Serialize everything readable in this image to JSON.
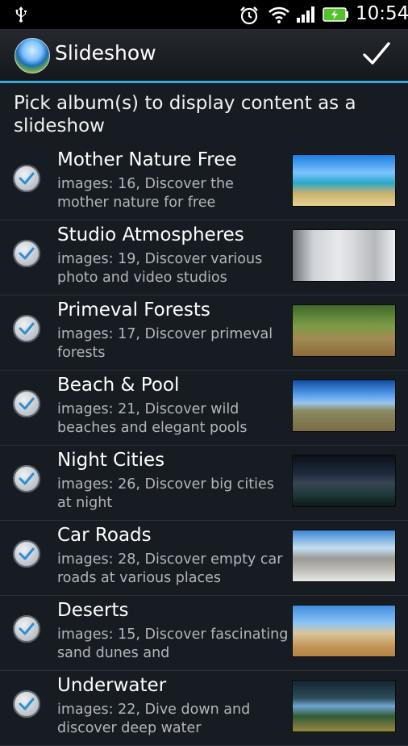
{
  "status_bar": {
    "time": "10:54",
    "icons": [
      "usb-icon",
      "alarm-icon",
      "wifi-icon",
      "signal-icon",
      "battery-charging-icon"
    ]
  },
  "action_bar": {
    "title": "Slideshow",
    "app_icon": "panorama-globe-icon",
    "confirm_icon": "checkmark-icon"
  },
  "heading": "Pick album(s) to display content as a slideshow",
  "albums": [
    {
      "name": "Mother Nature Free",
      "description": "images: 16, Discover the mother nature for free",
      "checked": true
    },
    {
      "name": "Studio Atmospheres",
      "description": "images: 19, Discover various photo and video studios",
      "checked": true
    },
    {
      "name": "Primeval Forests",
      "description": "images: 17, Discover primeval forests",
      "checked": true
    },
    {
      "name": "Beach & Pool",
      "description": "images: 21, Discover wild beaches and elegant pools",
      "checked": true
    },
    {
      "name": "Night Cities",
      "description": "images: 26, Discover big cities at night",
      "checked": true
    },
    {
      "name": "Car Roads",
      "description": "images: 28, Discover empty car roads at various places",
      "checked": true
    },
    {
      "name": "Deserts",
      "description": "images: 15, Discover fascinating sand dunes and",
      "checked": true
    },
    {
      "name": "Underwater",
      "description": "images: 22, Dive down and discover deep water",
      "checked": true
    }
  ],
  "colors": {
    "accent": "#3aa7da",
    "background": "#171c22",
    "check": "#2d8fd0"
  }
}
